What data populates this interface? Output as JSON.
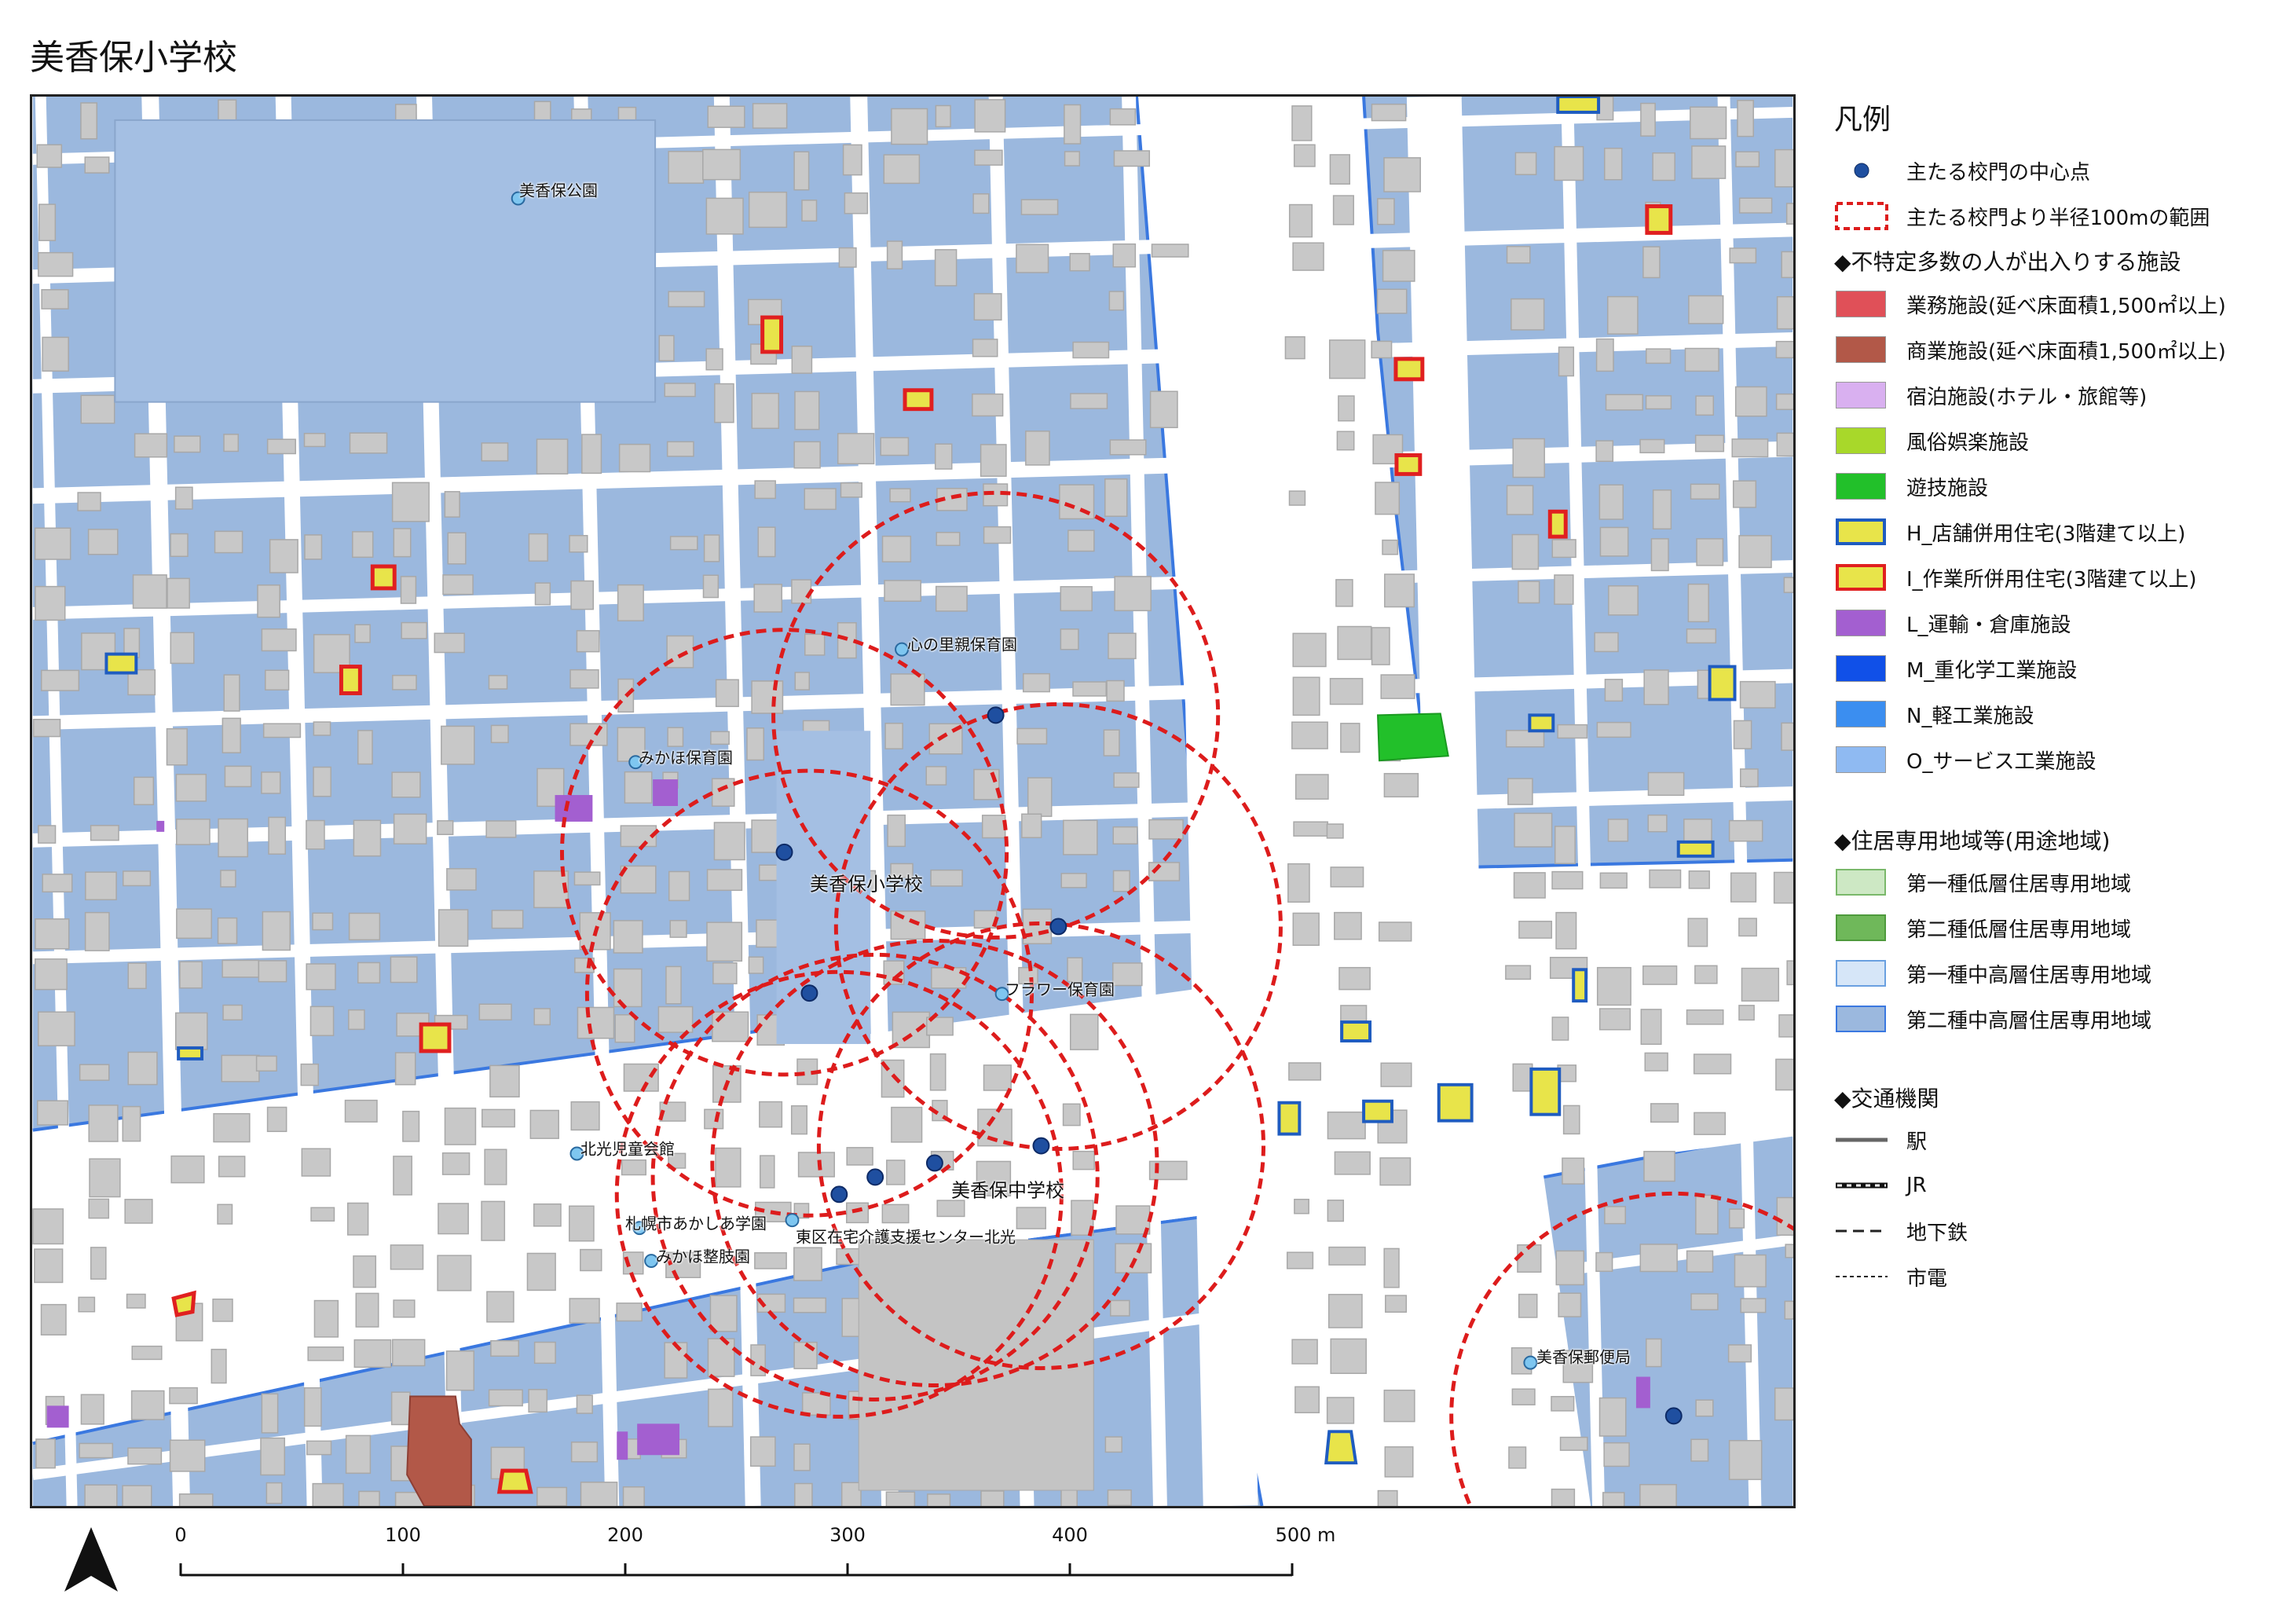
{
  "title": "美香保小学校",
  "colors": {
    "district_blue": "#9bb8de",
    "road_white": "#ffffff",
    "building_gray": "#c8c8c8",
    "circle_red": "#dd1c1c",
    "gate_blue": "#1f4fa0",
    "store_housing_fill": "#e8e44a",
    "workshop_housing_border": "#e02020",
    "warehouse_purple": "#a35fd0",
    "game_green": "#22c02a",
    "commercial_brown": "#b25848"
  },
  "map": {
    "labels": {
      "mikaho_park": "美香保公園",
      "kokoronosato": "心の里親保育園",
      "mikaho_nursery": "みかほ保育園",
      "mikaho_elem": "美香保小学校",
      "flower_nursery": "フラワー保育園",
      "kitamitsu_hall": "北光児童会館",
      "mikaho_jhs": "美香保中学校",
      "akashia": "札幌市あかしあ学園",
      "kaigo_center": "東区在宅介護支援センター北光",
      "seitai": "みかほ整肢園",
      "post_office": "美香保郵便局"
    },
    "gate_points": [
      {
        "id": "g1",
        "label": "gate"
      },
      {
        "id": "g2",
        "label": "gate"
      },
      {
        "id": "g3",
        "label": "gate"
      },
      {
        "id": "g4",
        "label": "gate"
      },
      {
        "id": "g5",
        "label": "gate"
      },
      {
        "id": "g6",
        "label": "gate"
      },
      {
        "id": "g7",
        "label": "gate"
      },
      {
        "id": "g8",
        "label": "gate"
      },
      {
        "id": "g9",
        "label": "gate"
      }
    ]
  },
  "legend": {
    "title": "凡例",
    "gate_point": "主たる校門の中心点",
    "radius_range": "主たる校門より半径100mの範囲",
    "facilities_heading": "◆不特定多数の人が出入りする施設",
    "business": "業務施設(延べ床面積1,500㎡以上)",
    "commercial": "商業施設(延べ床面積1,500㎡以上)",
    "lodging": "宿泊施設(ホテル・旅館等)",
    "entertainment": "風俗娯楽施設",
    "amusement": "遊技施設",
    "store_housing": "H_店舗併用住宅(3階建て以上)",
    "workshop_housing": "I_作業所併用住宅(3階建て以上)",
    "transport": "L_運輸・倉庫施設",
    "heavy_industry": "M_重化学工業施設",
    "light_industry": "N_軽工業施設",
    "service_industry": "O_サービス工業施設",
    "residential_heading": "◆住居専用地域等(用途地域)",
    "low_rise_1": "第一種低層住居専用地域",
    "low_rise_2": "第二種低層住居専用地域",
    "mid_high_1": "第一種中高層住居専用地域",
    "mid_high_2": "第二種中高層住居専用地域",
    "transport_heading": "◆交通機関",
    "station": "駅",
    "jr": "JR",
    "subway": "地下鉄",
    "tram": "市電"
  },
  "scale_bar": {
    "ticks": [
      "0",
      "100",
      "200",
      "300",
      "400",
      "500 m"
    ]
  }
}
